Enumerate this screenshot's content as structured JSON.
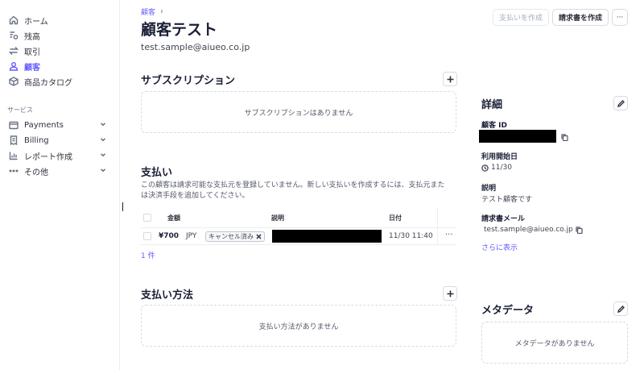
{
  "sidebar": {
    "items": [
      {
        "label": "ホーム",
        "icon": "home-icon"
      },
      {
        "label": "残高",
        "icon": "balance-icon"
      },
      {
        "label": "取引",
        "icon": "transfer-icon"
      },
      {
        "label": "顧客",
        "icon": "person-icon",
        "active": true
      },
      {
        "label": "商品カタログ",
        "icon": "box-icon"
      }
    ],
    "section_label": "サービス",
    "services": [
      {
        "label": "Payments",
        "icon": "wallet-icon"
      },
      {
        "label": "Billing",
        "icon": "invoice-icon"
      },
      {
        "label": "レポート作成",
        "icon": "chart-icon"
      },
      {
        "label": "その他",
        "icon": "dots-icon"
      }
    ]
  },
  "header": {
    "breadcrumb": "顧客",
    "breadcrumb_sep": "›",
    "title": "顧客テスト",
    "email": "test.sample@aiueo.co.jp",
    "actions": {
      "create_payment": "支払いを作成",
      "create_invoice": "請求書を作成",
      "more": "···"
    }
  },
  "subscriptions": {
    "title": "サブスクリプション",
    "empty": "サブスクリプションはありません"
  },
  "payments": {
    "title": "支払い",
    "description": "この顧客は請求可能な支払元を登録していません。新しい支払いを作成するには、支払元または決済手段を追加してください。",
    "columns": {
      "amount": "金額",
      "description": "説明",
      "date": "日付"
    },
    "rows": [
      {
        "amount": "¥700",
        "currency": "JPY",
        "status": "キャンセル済み",
        "date": "11/30 11:40",
        "more": "···"
      }
    ],
    "count": "1 件"
  },
  "payment_methods": {
    "title": "支払い方法",
    "empty": "支払い方法がありません"
  },
  "details": {
    "title": "詳細",
    "customer_id_label": "顧客 ID",
    "since_label": "利用開始日",
    "since_value": "11/30",
    "description_label": "説明",
    "description_value": "テスト顧客です",
    "invoice_email_label": "請求書メール",
    "invoice_email_value": "test.sample@aiueo.co.jp",
    "show_more": "さらに表示"
  },
  "metadata": {
    "title": "メタデータ",
    "empty": "メタデータがありません"
  },
  "colors": {
    "accent": "#635bff",
    "text": "#1a1f36",
    "border": "#d5dbe1"
  }
}
